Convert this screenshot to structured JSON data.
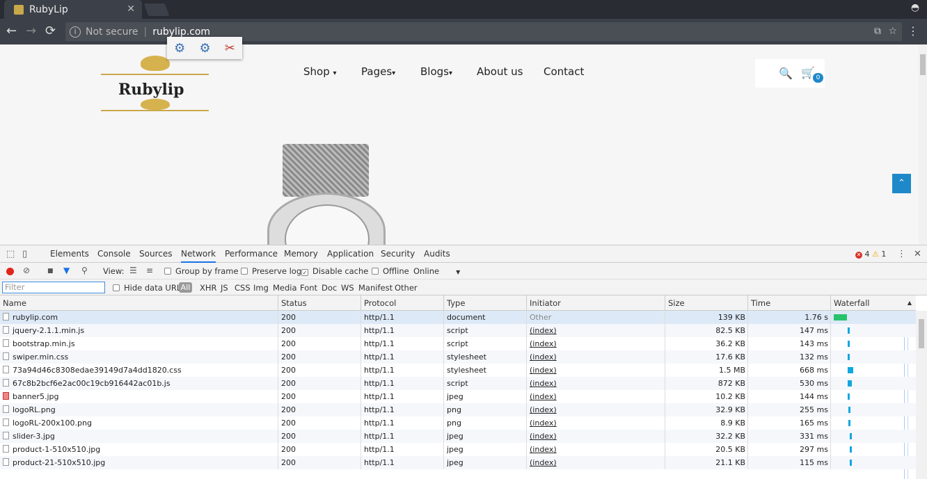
{
  "browser": {
    "tab_title": "RubyLip",
    "tab_close": "✕",
    "back": "←",
    "forward": "→",
    "reload": "⟳",
    "info_glyph": "i",
    "not_secure": "Not secure",
    "separator": "|",
    "url": "rubylip.com",
    "translate_glyph": "⧉",
    "star_glyph": "☆",
    "menu_glyph": "⋮",
    "incognito_glyph": "◓"
  },
  "extension_popup": {
    "icons": [
      "gear-icon",
      "gear-icon",
      "tools-icon"
    ],
    "glyphs": [
      "⚙",
      "⚙",
      "✂"
    ]
  },
  "site": {
    "logo_text": "Rubylip",
    "nav": [
      "Shop",
      "Pages",
      "Blogs",
      "About us",
      "Contact"
    ],
    "dropdown_glyph": "▾",
    "search_glyph": "🔍",
    "cart_glyph": "🛒",
    "cart_count": "0",
    "to_top_glyph": "⌃"
  },
  "devtools": {
    "tabs": [
      "Elements",
      "Console",
      "Sources",
      "Network",
      "Performance",
      "Memory",
      "Application",
      "Security",
      "Audits"
    ],
    "active_tab": "Network",
    "error_count": "4",
    "warning_count": "1",
    "error_glyph": "✕",
    "warning_glyph": "⚠",
    "menu_glyph": "⋮",
    "close_glyph": "✕",
    "inspect_glyph": "⬚",
    "device_glyph": "▯",
    "toolbar": {
      "clear_glyph": "⊘",
      "camera_glyph": "■",
      "filter_glyph": "▼",
      "search_glyph": "⚲",
      "view_label": "View:",
      "list_view_glyph": "☰",
      "tree_view_glyph": "≡",
      "group_by_frame": "Group by frame",
      "preserve_log": "Preserve log",
      "disable_cache": "Disable cache",
      "offline": "Offline",
      "throttle": "Online",
      "throttle_caret": "▼",
      "check_glyph": "✓"
    },
    "filter_bar": {
      "placeholder": "Filter",
      "hide_data_urls": "Hide data URLs",
      "types": [
        "All",
        "XHR",
        "JS",
        "CSS",
        "Img",
        "Media",
        "Font",
        "Doc",
        "WS",
        "Manifest",
        "Other"
      ]
    },
    "columns": [
      "Name",
      "Status",
      "Protocol",
      "Type",
      "Initiator",
      "Size",
      "Time",
      "Waterfall"
    ],
    "sort_glyph": "▲",
    "requests": [
      {
        "name": "rubylip.com",
        "status": "200",
        "protocol": "http/1.1",
        "type": "document",
        "initiator": "Other",
        "size": "139 KB",
        "time": "1.76 s",
        "wf_start": 0.0,
        "wf_len": 0.165
      },
      {
        "name": "jquery-2.1.1.min.js",
        "status": "200",
        "protocol": "http/1.1",
        "type": "script",
        "initiator": "(index)",
        "size": "82.5 KB",
        "time": "147 ms",
        "wf_start": 0.17,
        "wf_len": 0.025
      },
      {
        "name": "bootstrap.min.js",
        "status": "200",
        "protocol": "http/1.1",
        "type": "script",
        "initiator": "(index)",
        "size": "36.2 KB",
        "time": "143 ms",
        "wf_start": 0.17,
        "wf_len": 0.025
      },
      {
        "name": "swiper.min.css",
        "status": "200",
        "protocol": "http/1.1",
        "type": "stylesheet",
        "initiator": "(index)",
        "size": "17.6 KB",
        "time": "132 ms",
        "wf_start": 0.17,
        "wf_len": 0.025
      },
      {
        "name": "73a94d46c8308edae39149d7a4dd1820.css",
        "status": "200",
        "protocol": "http/1.1",
        "type": "stylesheet",
        "initiator": "(index)",
        "size": "1.5 MB",
        "time": "668 ms",
        "wf_start": 0.17,
        "wf_len": 0.07
      },
      {
        "name": "67c8b2bcf6e2ac00c19cb916442ac01b.js",
        "status": "200",
        "protocol": "http/1.1",
        "type": "script",
        "initiator": "(index)",
        "size": "872 KB",
        "time": "530 ms",
        "wf_start": 0.17,
        "wf_len": 0.06
      },
      {
        "name": "banner5.jpg",
        "status": "200",
        "protocol": "http/1.1",
        "type": "jpeg",
        "initiator": "(index)",
        "size": "10.2 KB",
        "time": "144 ms",
        "wf_start": 0.17,
        "wf_len": 0.025,
        "image": true
      },
      {
        "name": "logoRL.png",
        "status": "200",
        "protocol": "http/1.1",
        "type": "png",
        "initiator": "(index)",
        "size": "32.9 KB",
        "time": "255 ms",
        "wf_start": 0.18,
        "wf_len": 0.025
      },
      {
        "name": "logoRL-200x100.png",
        "status": "200",
        "protocol": "http/1.1",
        "type": "png",
        "initiator": "(index)",
        "size": "8.9 KB",
        "time": "165 ms",
        "wf_start": 0.18,
        "wf_len": 0.02
      },
      {
        "name": "slider-3.jpg",
        "status": "200",
        "protocol": "http/1.1",
        "type": "jpeg",
        "initiator": "(index)",
        "size": "32.2 KB",
        "time": "331 ms",
        "wf_start": 0.2,
        "wf_len": 0.03
      },
      {
        "name": "product-1-510x510.jpg",
        "status": "200",
        "protocol": "http/1.1",
        "type": "jpeg",
        "initiator": "(index)",
        "size": "20.5 KB",
        "time": "297 ms",
        "wf_start": 0.2,
        "wf_len": 0.03
      },
      {
        "name": "product-21-510x510.jpg",
        "status": "200",
        "protocol": "http/1.1",
        "type": "jpeg",
        "initiator": "(index)",
        "size": "21.1 KB",
        "time": "115 ms",
        "wf_start": 0.2,
        "wf_len": 0.02
      }
    ]
  }
}
